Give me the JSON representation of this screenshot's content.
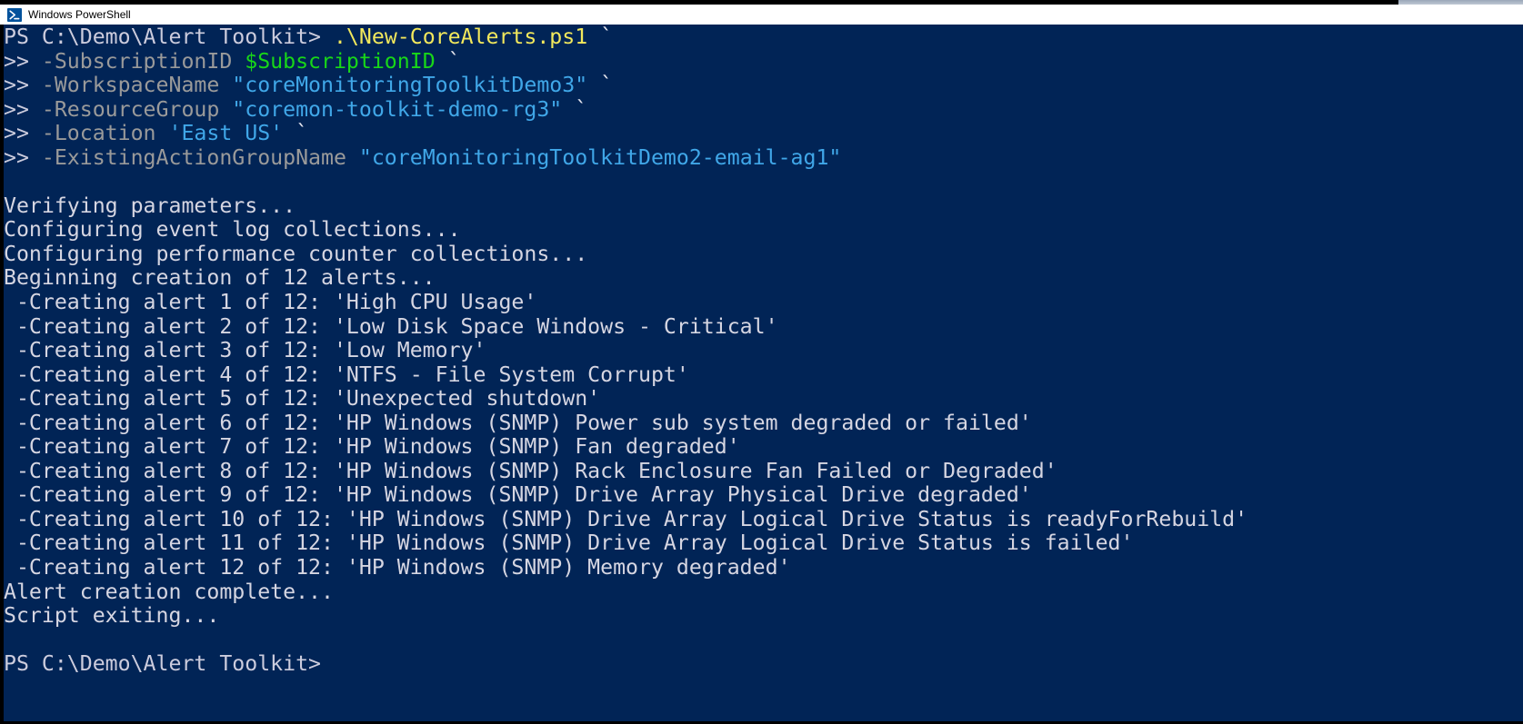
{
  "window": {
    "title": "Windows PowerShell",
    "icon": "powershell-icon",
    "background_color": "#012456",
    "titlebar_background": "#ffffff",
    "foreground_color": "#ccccdd"
  },
  "colors": {
    "command": "#f2e85c",
    "parameter": "#9a9a9a",
    "variable": "#18d718",
    "string": "#40a7e8",
    "output": "#d6d6e2"
  },
  "console": {
    "prompt": "PS C:\\Demo\\Alert Toolkit>",
    "continuation_marker": ">>",
    "command_line": {
      "script": " .\\New-CoreAlerts.ps1",
      "trailing_tick": " `"
    },
    "parameters": [
      {
        "marker": ">>",
        "name": " -SubscriptionID ",
        "value": "$SubscriptionID",
        "value_type": "variable",
        "tick": " `"
      },
      {
        "marker": ">>",
        "name": " -WorkspaceName ",
        "value": "\"coreMonitoringToolkitDemo3\"",
        "value_type": "string",
        "tick": " `"
      },
      {
        "marker": ">>",
        "name": " -ResourceGroup ",
        "value": "\"coremon-toolkit-demo-rg3\"",
        "value_type": "string",
        "tick": " `"
      },
      {
        "marker": ">>",
        "name": " -Location ",
        "value": "'East US'",
        "value_type": "string",
        "tick": " `"
      },
      {
        "marker": ">>",
        "name": " -ExistingActionGroupName ",
        "value": "\"coreMonitoringToolkitDemo2-email-ag1\"",
        "value_type": "string",
        "tick": ""
      }
    ],
    "output_lines": [
      "Verifying parameters...",
      "Configuring event log collections...",
      "Configuring performance counter collections...",
      "Beginning creation of 12 alerts...",
      " -Creating alert 1 of 12: 'High CPU Usage'",
      " -Creating alert 2 of 12: 'Low Disk Space Windows - Critical'",
      " -Creating alert 3 of 12: 'Low Memory'",
      " -Creating alert 4 of 12: 'NTFS - File System Corrupt'",
      " -Creating alert 5 of 12: 'Unexpected shutdown'",
      " -Creating alert 6 of 12: 'HP Windows (SNMP) Power sub system degraded or failed'",
      " -Creating alert 7 of 12: 'HP Windows (SNMP) Fan degraded'",
      " -Creating alert 8 of 12: 'HP Windows (SNMP) Rack Enclosure Fan Failed or Degraded'",
      " -Creating alert 9 of 12: 'HP Windows (SNMP) Drive Array Physical Drive degraded'",
      " -Creating alert 10 of 12: 'HP Windows (SNMP) Drive Array Logical Drive Status is readyForRebuild'",
      " -Creating alert 11 of 12: 'HP Windows (SNMP) Drive Array Logical Drive Status is failed'",
      " -Creating alert 12 of 12: 'HP Windows (SNMP) Memory degraded'",
      "Alert creation complete...",
      "Script exiting..."
    ],
    "final_prompt": "PS C:\\Demo\\Alert Toolkit>",
    "alert_total": 12
  }
}
